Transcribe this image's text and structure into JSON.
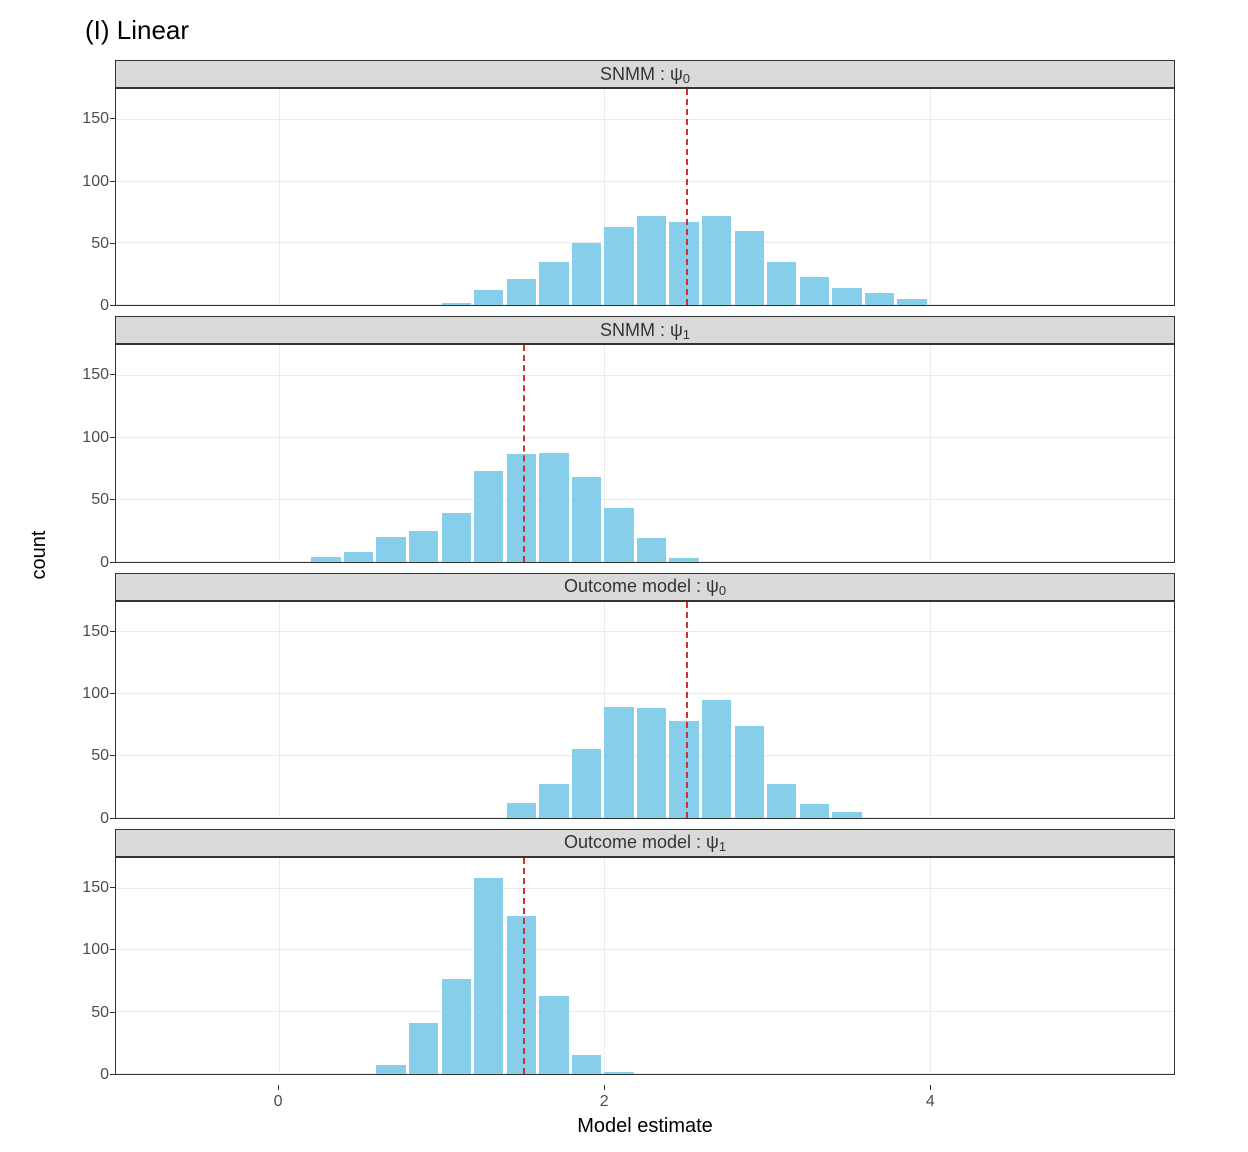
{
  "title": "(I) Linear",
  "xlabel": "Model estimate",
  "ylabel": "count",
  "x_range": [
    -1,
    5.5
  ],
  "x_ticks": [
    0,
    2,
    4
  ],
  "y_range": [
    0,
    175
  ],
  "y_ticks": [
    0,
    50,
    100,
    150
  ],
  "bar_color": "#87CEEB",
  "vline_color": "#cc3333",
  "chart_data": [
    {
      "strip": "SNMM :  ψ",
      "strip_sub": "0",
      "vline": 2.5,
      "bin_width": 0.2,
      "type": "histogram",
      "bins": [
        {
          "x": 1.1,
          "count": 2
        },
        {
          "x": 1.3,
          "count": 12
        },
        {
          "x": 1.5,
          "count": 21
        },
        {
          "x": 1.7,
          "count": 35
        },
        {
          "x": 1.9,
          "count": 50
        },
        {
          "x": 2.1,
          "count": 63
        },
        {
          "x": 2.3,
          "count": 72
        },
        {
          "x": 2.5,
          "count": 67
        },
        {
          "x": 2.7,
          "count": 72
        },
        {
          "x": 2.9,
          "count": 60
        },
        {
          "x": 3.1,
          "count": 35
        },
        {
          "x": 3.3,
          "count": 23
        },
        {
          "x": 3.5,
          "count": 14
        },
        {
          "x": 3.7,
          "count": 10
        },
        {
          "x": 3.9,
          "count": 5
        }
      ]
    },
    {
      "strip": "SNMM :  ψ",
      "strip_sub": "1",
      "vline": 1.5,
      "bin_width": 0.2,
      "type": "histogram",
      "bins": [
        {
          "x": 0.3,
          "count": 4
        },
        {
          "x": 0.5,
          "count": 8
        },
        {
          "x": 0.7,
          "count": 20
        },
        {
          "x": 0.9,
          "count": 25
        },
        {
          "x": 1.1,
          "count": 39
        },
        {
          "x": 1.3,
          "count": 73
        },
        {
          "x": 1.5,
          "count": 87
        },
        {
          "x": 1.7,
          "count": 88
        },
        {
          "x": 1.9,
          "count": 68
        },
        {
          "x": 2.1,
          "count": 43
        },
        {
          "x": 2.3,
          "count": 19
        },
        {
          "x": 2.5,
          "count": 3
        }
      ]
    },
    {
      "strip": "Outcome model :  ψ",
      "strip_sub": "0",
      "vline": 2.5,
      "bin_width": 0.2,
      "type": "histogram",
      "bins": [
        {
          "x": 1.5,
          "count": 12
        },
        {
          "x": 1.7,
          "count": 27
        },
        {
          "x": 1.9,
          "count": 56
        },
        {
          "x": 2.1,
          "count": 90
        },
        {
          "x": 2.3,
          "count": 89
        },
        {
          "x": 2.5,
          "count": 78
        },
        {
          "x": 2.7,
          "count": 95
        },
        {
          "x": 2.9,
          "count": 74
        },
        {
          "x": 3.1,
          "count": 27
        },
        {
          "x": 3.3,
          "count": 11
        },
        {
          "x": 3.5,
          "count": 5
        }
      ]
    },
    {
      "strip": "Outcome model :  ψ",
      "strip_sub": "1",
      "vline": 1.5,
      "bin_width": 0.2,
      "type": "histogram",
      "bins": [
        {
          "x": 0.7,
          "count": 7
        },
        {
          "x": 0.9,
          "count": 41
        },
        {
          "x": 1.1,
          "count": 77
        },
        {
          "x": 1.3,
          "count": 159
        },
        {
          "x": 1.5,
          "count": 128
        },
        {
          "x": 1.7,
          "count": 63
        },
        {
          "x": 1.9,
          "count": 15
        },
        {
          "x": 2.1,
          "count": 2
        }
      ]
    }
  ]
}
